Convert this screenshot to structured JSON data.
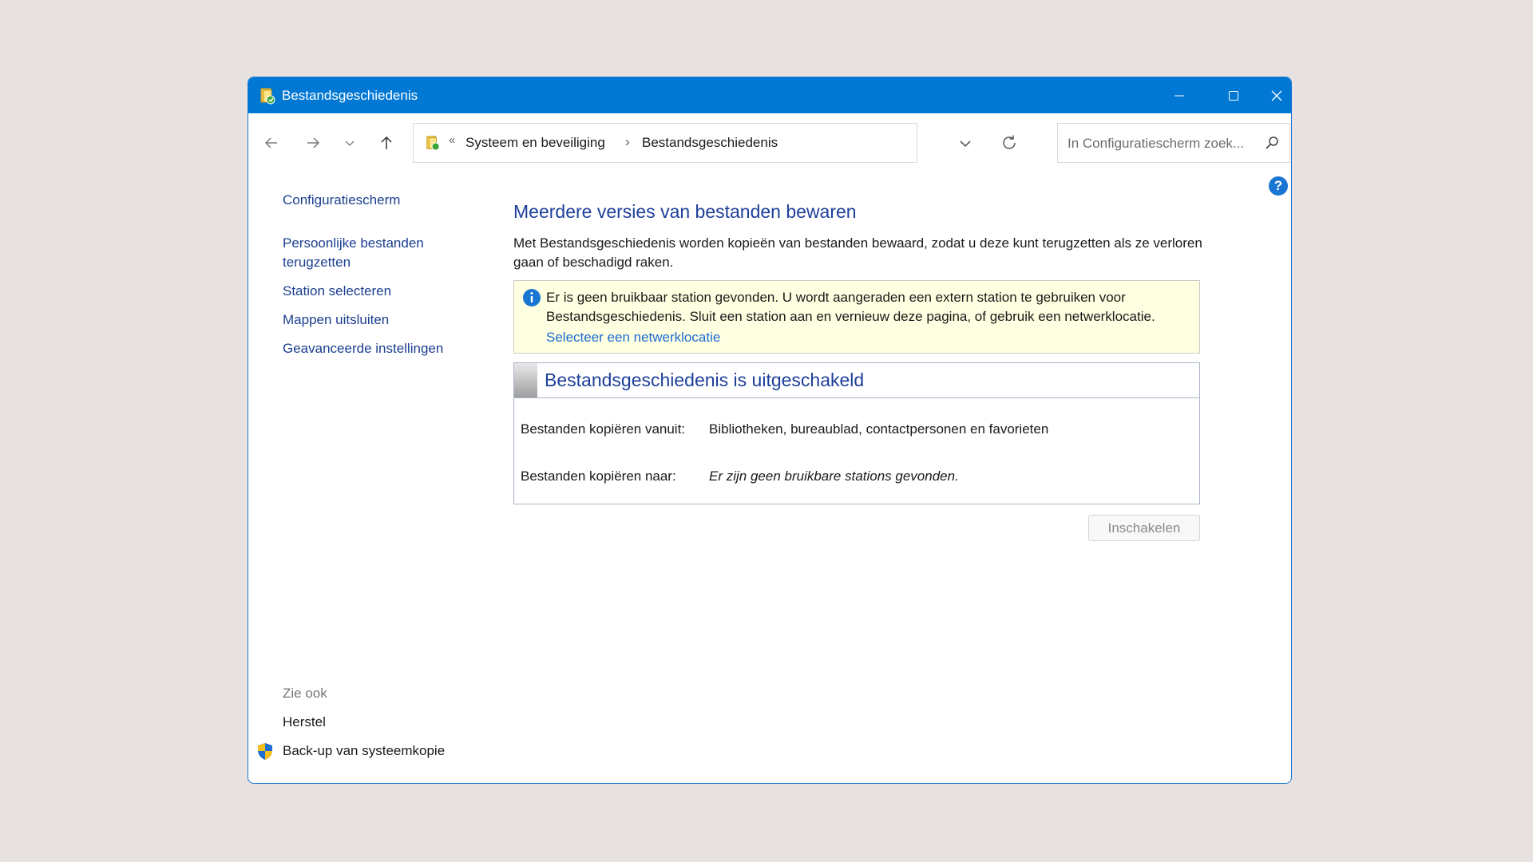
{
  "window": {
    "title": "Bestandsgeschiedenis"
  },
  "address_bar": {
    "separator": "«",
    "breadcrumbs": [
      "Systeem en beveiliging",
      "Bestandsgeschiedenis"
    ],
    "chevron": "›"
  },
  "search": {
    "placeholder": "In Configuratiescherm zoek..."
  },
  "sidebar": {
    "home": "Configuratiescherm",
    "links": [
      "Persoonlijke bestanden terugzetten",
      "Station selecteren",
      "Mappen uitsluiten",
      "Geavanceerde instellingen"
    ],
    "see_also_heading": "Zie ook",
    "see_also": [
      "Herstel",
      "Back-up van systeemkopie"
    ]
  },
  "main": {
    "heading": "Meerdere versies van bestanden bewaren",
    "description": "Met Bestandsgeschiedenis worden kopieën van bestanden bewaard, zodat u deze kunt terugzetten als ze verloren gaan of beschadigd raken.",
    "info": {
      "text": "Er is geen bruikbaar station gevonden. U wordt aangeraden een extern station te gebruiken voor Bestandsgeschiedenis. Sluit een station aan en vernieuw deze pagina, of gebruik een netwerklocatie.",
      "link": "Selecteer een netwerklocatie"
    },
    "status": {
      "title": "Bestandsgeschiedenis is uitgeschakeld",
      "copy_from_label": "Bestanden kopiëren vanuit:",
      "copy_from_value": "Bibliotheken, bureaublad, contactpersonen en favorieten",
      "copy_to_label": "Bestanden kopiëren naar:",
      "copy_to_value": "Er zijn geen bruikbare stations gevonden."
    },
    "enable_button": "Inschakelen"
  },
  "colors": {
    "titlebar": "#0078d4",
    "link": "#1b3f8f",
    "heading": "#1e3f9a",
    "info_background": "#ffffe1"
  }
}
